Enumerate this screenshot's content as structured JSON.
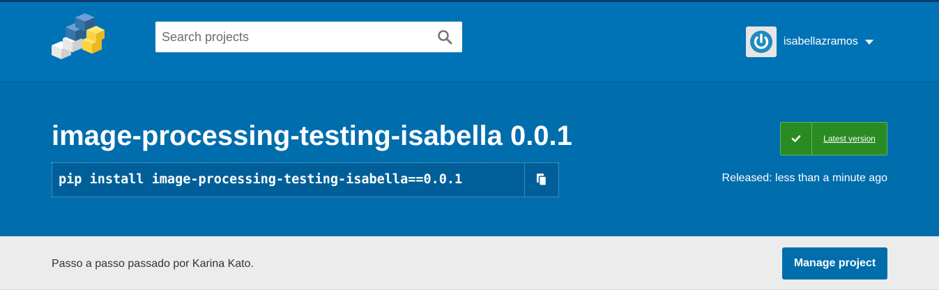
{
  "header": {
    "search": {
      "placeholder": "Search projects",
      "value": ""
    },
    "user": {
      "username": "isabellazramos"
    }
  },
  "package": {
    "title": "image-processing-testing-isabella 0.0.1",
    "pip_command": "pip install image-processing-testing-isabella==0.0.1",
    "latest_label": "Latest version",
    "released": "Released: less than a minute ago"
  },
  "summary": {
    "text": "Passo a passo passado por Karina Kato.",
    "manage_label": "Manage project"
  },
  "icons": {
    "logo": "pypi-logo-icon",
    "search": "search-icon",
    "avatar": "gravatar-power-icon",
    "dropdown": "caret-down-icon",
    "copy": "copy-icon",
    "check": "check-icon"
  },
  "colors": {
    "header_bg": "#0073b7",
    "banner_bg": "#006dad",
    "latest_bg": "#2a8b22",
    "subbar_bg": "#ececec",
    "button_bg": "#006dad"
  }
}
